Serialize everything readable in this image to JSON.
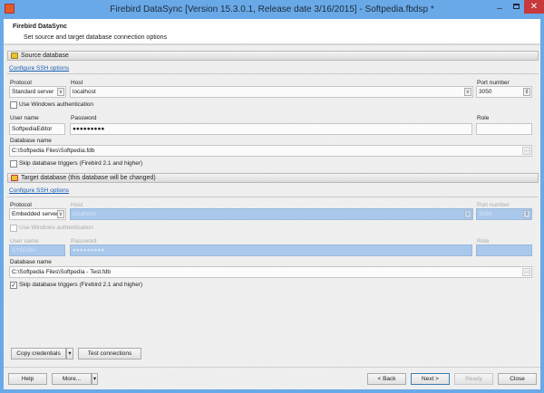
{
  "window": {
    "title": "Firebird DataSync [Version 15.3.0.1, Release date 3/16/2015] - Softpedia.fbdsp *",
    "minimize": "‒",
    "close": "✕"
  },
  "header": {
    "title": "Firebird DataSync",
    "subtitle": "Set source and target database connection options"
  },
  "source": {
    "section_label": "Source database",
    "ssh_link": "Configure SSH options",
    "protocol_label": "Protocol",
    "protocol": "Standard server",
    "host_label": "Host",
    "host": "localhost",
    "port_label": "Port number",
    "port": "3050",
    "windows_auth_label": "Use Windows authentication",
    "windows_auth": false,
    "user_label": "User name",
    "user": "SoftpediaEditor",
    "password_label": "Password",
    "password": "●●●●●●●●●",
    "role_label": "Role",
    "role": "",
    "dbname_label": "Database name",
    "dbname": "C:\\Softpedia Files\\Softpedia.fdb",
    "skip_triggers_label": "Skip database triggers (Firebird 2.1 and higher)",
    "skip_triggers": false
  },
  "target": {
    "section_label": "Target database (this database will be changed)",
    "ssh_link": "Configure SSH options",
    "protocol_label": "Protocol",
    "protocol": "Embedded server",
    "host_label": "Host",
    "host": "localhost",
    "port_label": "Port number",
    "port": "3050",
    "windows_auth_label": "Use Windows authentication",
    "windows_auth": false,
    "user_label": "User name",
    "user": "SYSDBA",
    "password_label": "Password",
    "password": "●●●●●●●●●",
    "role_label": "Role",
    "role": "",
    "dbname_label": "Database name",
    "dbname": "C:\\Softpedia Files\\Softpedia - Test.fdb",
    "skip_triggers_label": "Skip database triggers (Firebird 2.1 and higher)",
    "skip_triggers": true
  },
  "actions": {
    "copy_credentials": "Copy credentials",
    "test_connections": "Test connections"
  },
  "footer": {
    "help": "Help",
    "more": "More...",
    "back": "< Back",
    "next": "Next >",
    "ready": "Ready",
    "close": "Close"
  },
  "glyphs": {
    "down": "v",
    "ellipsis": "...",
    "spin": "⇕",
    "check": "✓",
    "menu_arrow": "▾"
  }
}
